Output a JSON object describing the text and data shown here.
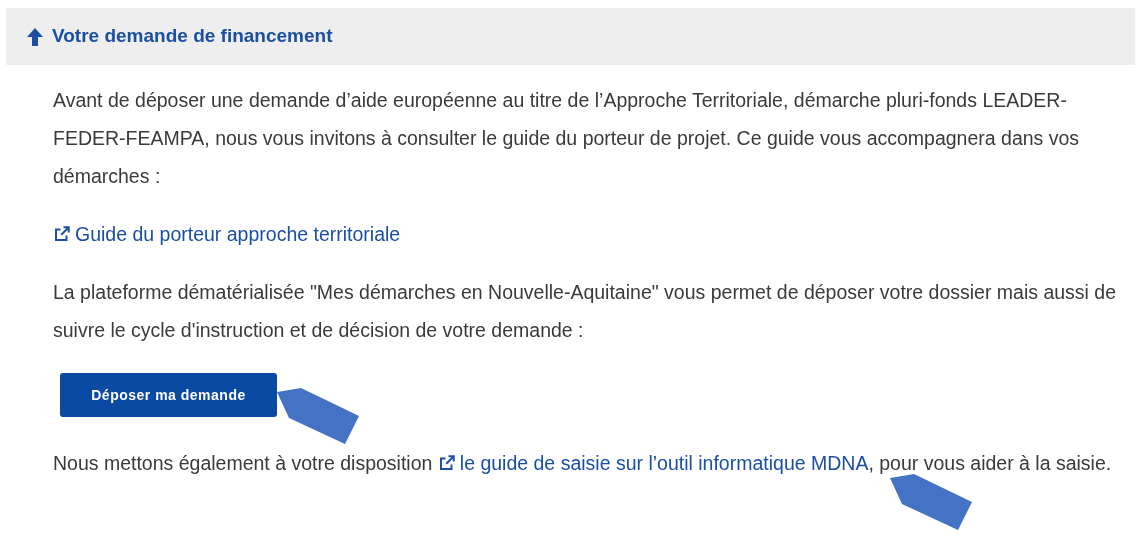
{
  "section": {
    "title": "Votre demande de financement",
    "expanded": true
  },
  "intro": "Avant de déposer une demande d’aide européenne au titre de l’Approche Territoriale, démarche pluri-fonds LEADER-FEDER-FEAMPA, nous vous invitons à consulter le guide du porteur de projet. Ce guide vous accompagnera dans vos démarches :",
  "guide_link": "Guide du porteur approche territoriale",
  "platform_text": "La plateforme dématérialisée \"Mes démarches en Nouvelle-Aquitaine\" vous permet de déposer votre dossier mais aussi de suivre le cycle d'instruction et de décision de votre demande :",
  "submit_button": "Déposer ma demande",
  "closing": {
    "before": "Nous mettons également à votre disposition",
    "link": "le guide de saisie sur l’outil informatique MDNA",
    "after": ", pour vous aider à la saisie."
  }
}
